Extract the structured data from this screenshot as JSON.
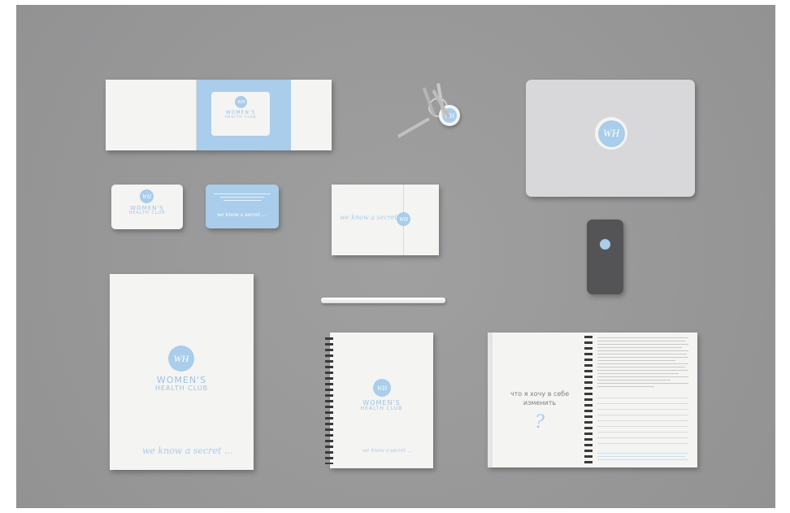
{
  "brand": {
    "logo_text": "WH",
    "name_line1": "WOMEN'S",
    "name_line2": "HEALTH CLUB",
    "tagline": "we know a secret ..."
  },
  "notebook": {
    "question_line1": "что я хочу в себе",
    "question_line2": "изменить",
    "question_mark": "?"
  },
  "colors": {
    "background": "#9a9a9b",
    "brand_blue": "#a9cdea",
    "paper": "#f4f4f3"
  }
}
